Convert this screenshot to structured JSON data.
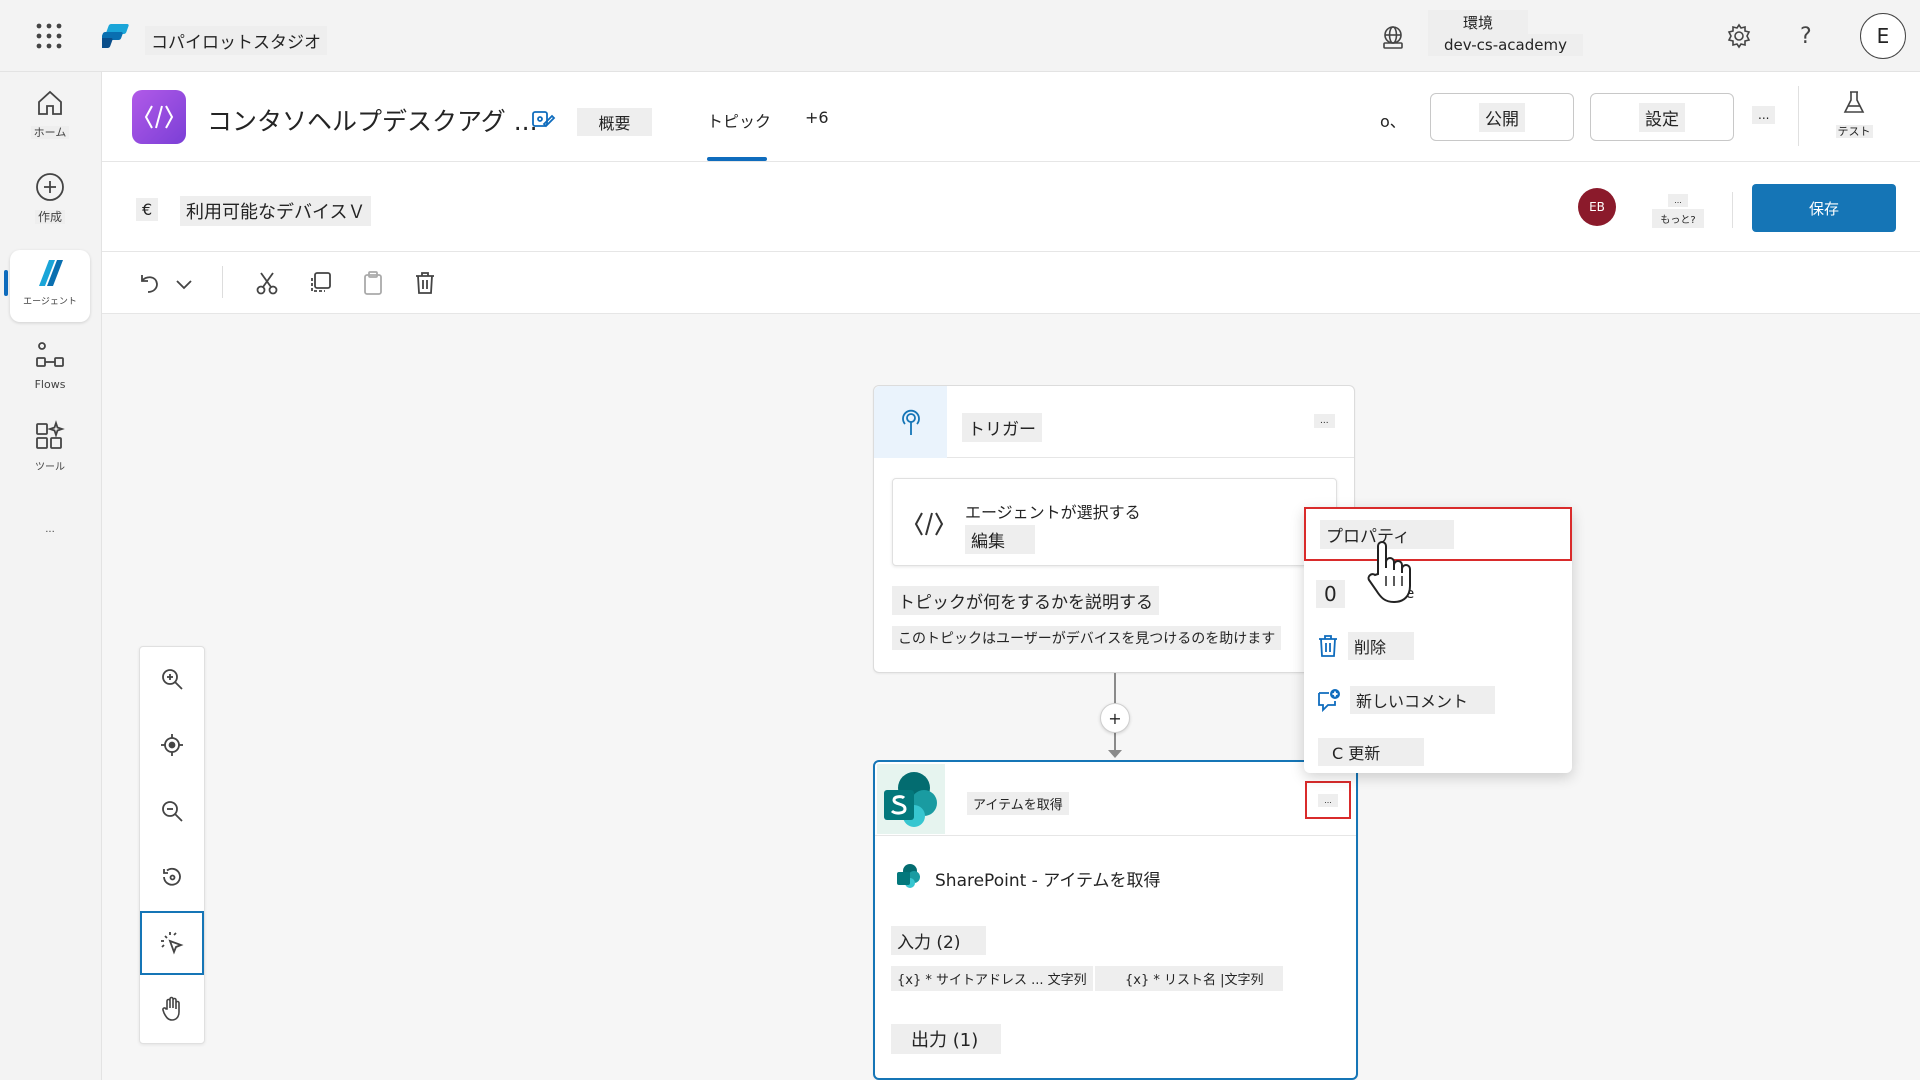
{
  "app": {
    "name": "コパイロットスタジオ"
  },
  "environment": {
    "label": "環境",
    "value": "dev-cs-academy"
  },
  "user": {
    "initial": "E"
  },
  "rail": {
    "items": [
      {
        "label": "ホーム"
      },
      {
        "label": "作成"
      },
      {
        "label": "エージェント"
      },
      {
        "label": "Flows"
      },
      {
        "label": "ツール"
      }
    ],
    "more": "..."
  },
  "header": {
    "agent_name": "コンタソヘルプデスクアグ ...",
    "tabs": [
      {
        "label": "概要"
      },
      {
        "label": "トピック"
      },
      {
        "label": "+6"
      }
    ],
    "status": "o、",
    "publish": "公開",
    "settings": "設定",
    "more": "...",
    "test": "テスト"
  },
  "topic": {
    "back_symbol": "€",
    "title": "利用可能なデバイスＶ",
    "user_badge": "EB",
    "more_dots": "...",
    "more_label": "もっと?",
    "save": "保存"
  },
  "trigger_node": {
    "title": "トリガー",
    "more": "...",
    "card_title": "エージェントが選択する",
    "card_action": "編集",
    "desc_label": "トピックが何をするかを説明する",
    "desc_value": "このトピックはユーザーがデバイスを見つけるのを助けます"
  },
  "add_symbol": "+",
  "get_items_node": {
    "title": "アイテムを取得",
    "more": "...",
    "connector_label": "SharePoint - アイテムを取得",
    "inputs_label": "入力 (2)",
    "chip_site": "{x} * サイトアドレス ... 文字列",
    "chip_list": "{x} * リスト名 |文字列",
    "outputs_label": "出力 (1)"
  },
  "context_menu": {
    "properties": "プロパティ",
    "rename_num": "0",
    "rename_tail": "ne",
    "delete": "削除",
    "new_comment": "新しいコメント",
    "refresh": "C 更新"
  }
}
